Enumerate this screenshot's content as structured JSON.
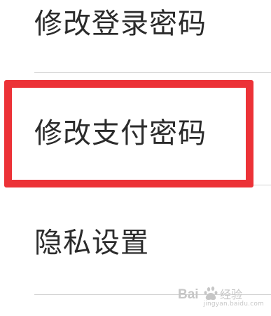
{
  "menu": {
    "items": [
      {
        "label": "修改登录密码"
      },
      {
        "label": "修改支付密码"
      },
      {
        "label": "隐私设置"
      }
    ],
    "highlight_color": "#ec3237"
  },
  "watermark": {
    "logo_text": "Bai 经验",
    "url": "jingyan.baidu.com"
  }
}
